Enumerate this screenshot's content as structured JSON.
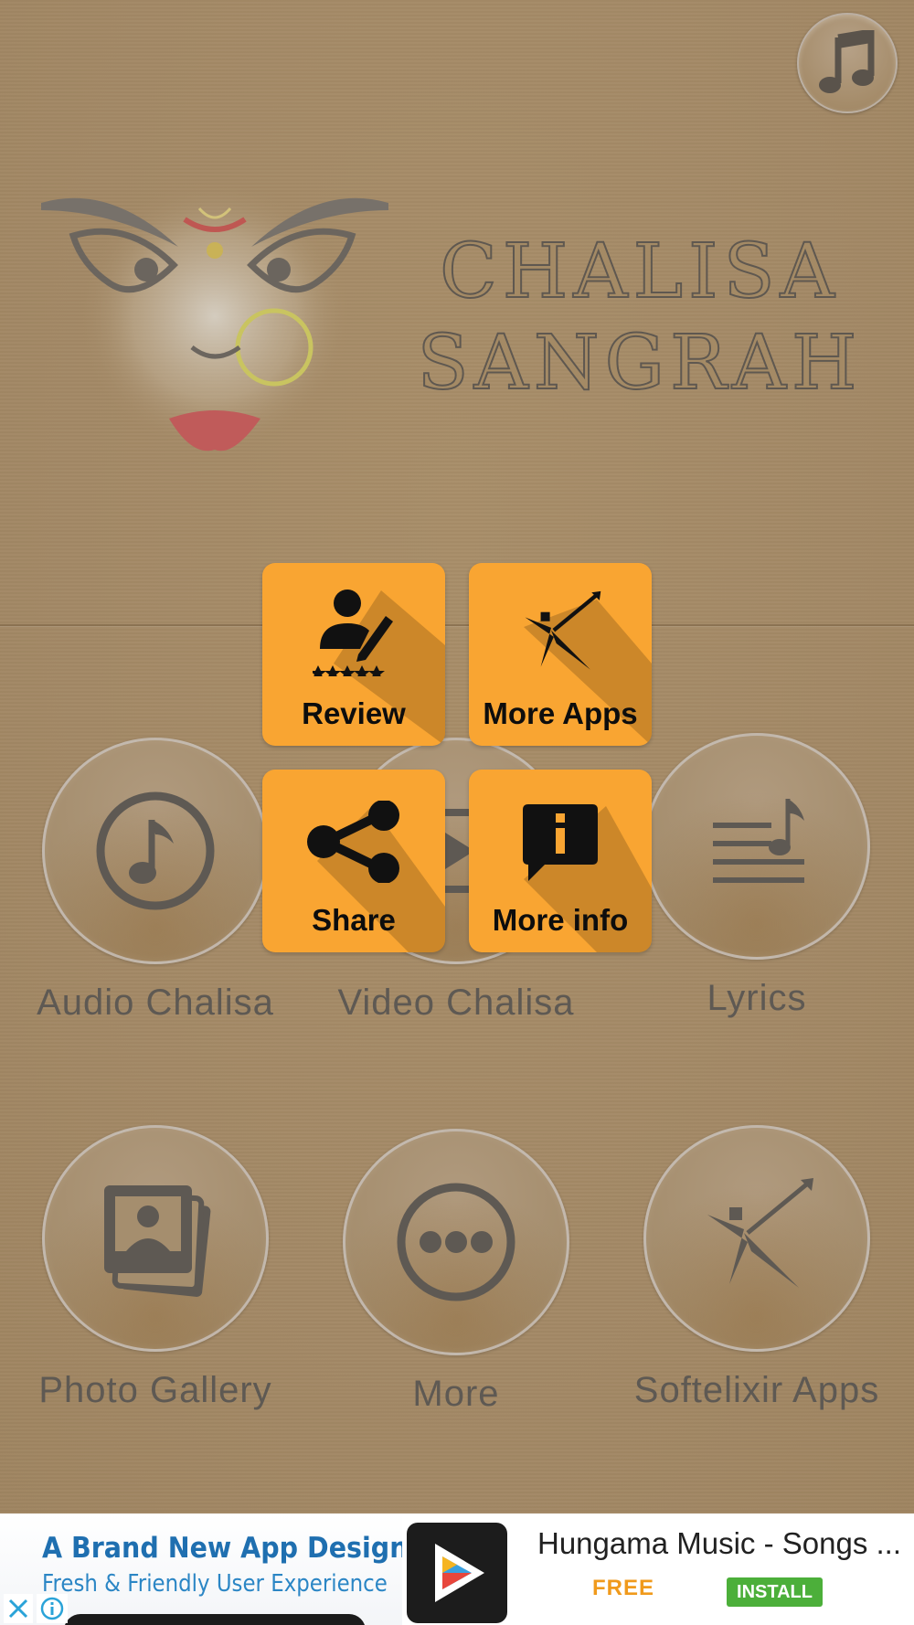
{
  "app": {
    "title_line1": "CHALISA",
    "title_line2": "SANGRAH"
  },
  "main_menu": [
    {
      "id": "audio-chalisa",
      "label": "Audio Chalisa",
      "icon": "music-note-circle-icon"
    },
    {
      "id": "video-chalisa",
      "label": "Video Chalisa",
      "icon": "video-play-icon"
    },
    {
      "id": "lyrics",
      "label": "Lyrics",
      "icon": "lyrics-icon"
    },
    {
      "id": "photo-gallery",
      "label": "Photo Gallery",
      "icon": "photo-gallery-icon"
    },
    {
      "id": "more",
      "label": "More",
      "icon": "more-dots-icon"
    },
    {
      "id": "softelixir-apps",
      "label": "Softelixir Apps",
      "icon": "softelixir-logo-icon"
    }
  ],
  "popup_menu": [
    {
      "id": "review",
      "label": "Review",
      "icon": "review-icon"
    },
    {
      "id": "more-apps",
      "label": "More Apps",
      "icon": "softelixir-logo-icon"
    },
    {
      "id": "share",
      "label": "Share",
      "icon": "share-icon"
    },
    {
      "id": "more-info",
      "label": "More info",
      "icon": "info-bubble-icon"
    }
  ],
  "ad": {
    "headline": "A Brand New App Design",
    "subline": "Fresh & Friendly User Experience",
    "app_title": "Hungama Music - Songs ...",
    "price": "FREE",
    "cta": "INSTALL"
  },
  "colors": {
    "background": "#a48a65",
    "tile": "#f9a532",
    "icon_gray": "#5e5953",
    "install_green": "#4caf3a",
    "free_orange": "#f09a1c"
  }
}
